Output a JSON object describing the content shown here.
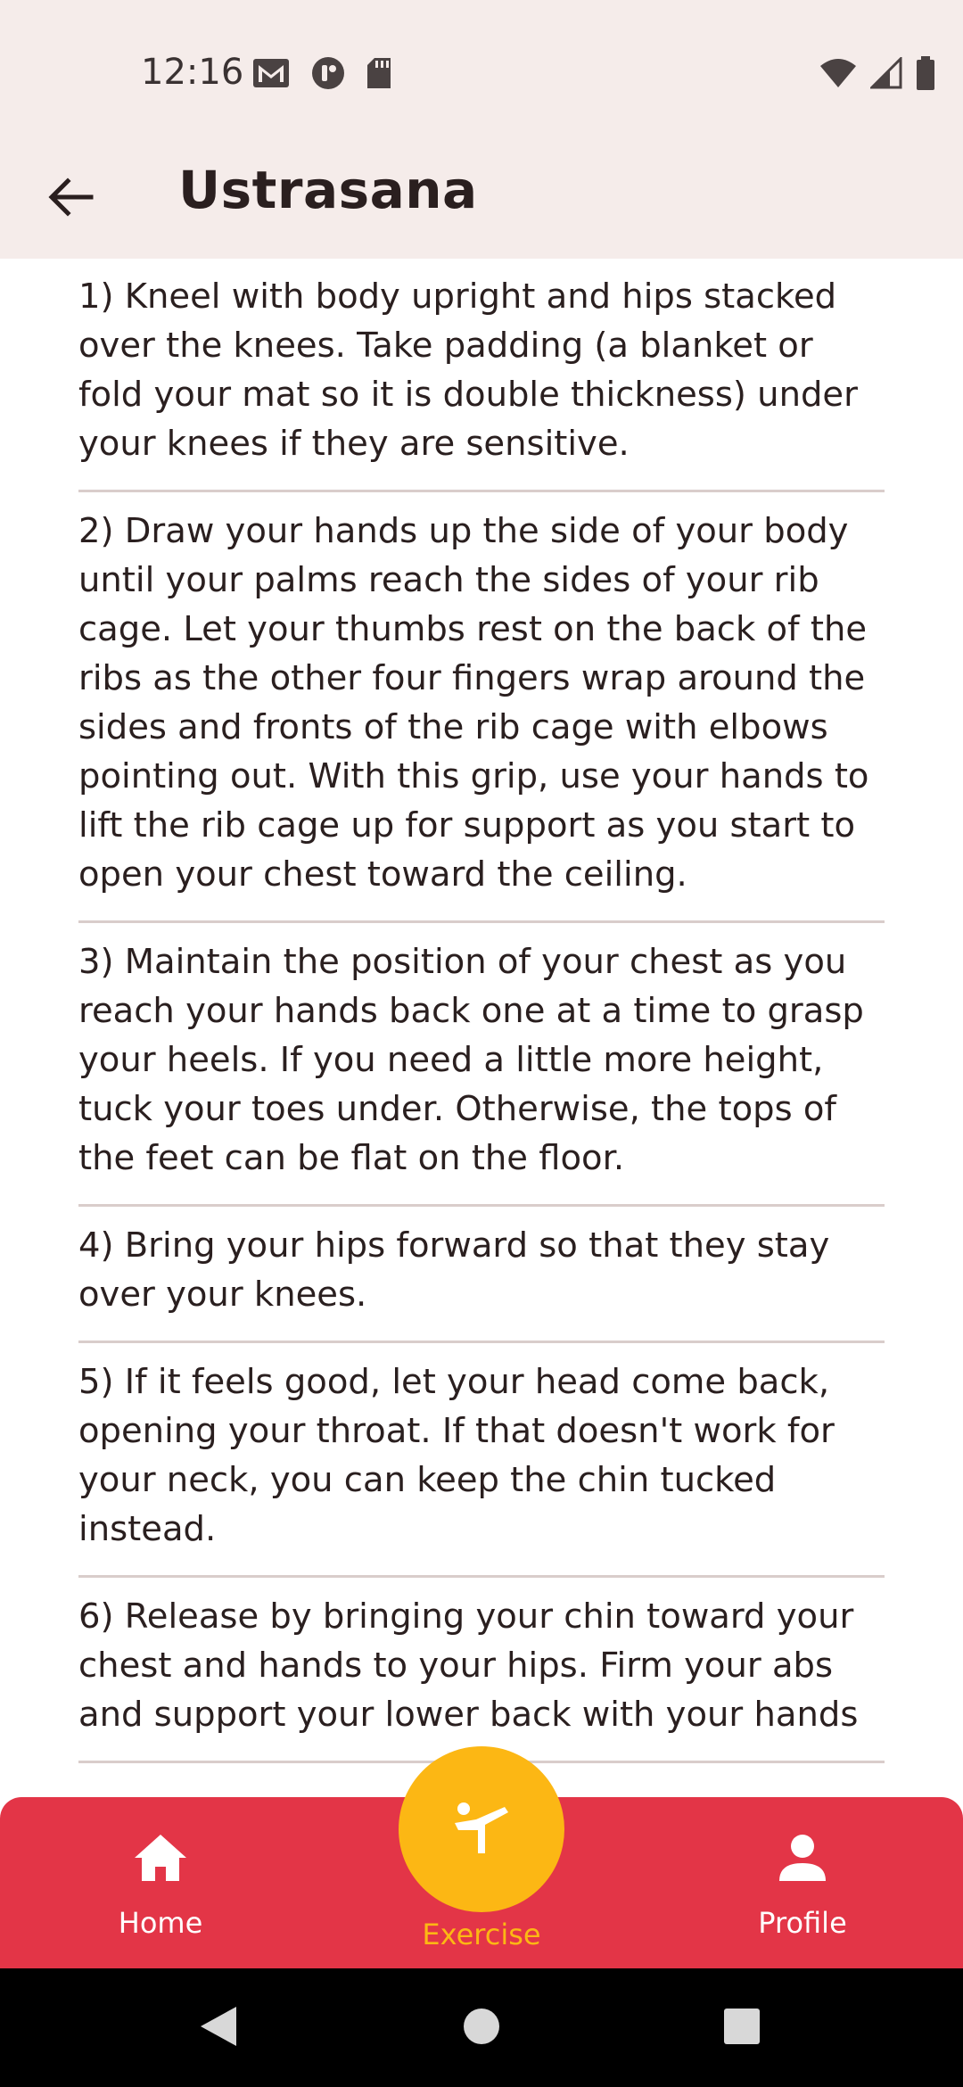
{
  "status_bar": {
    "time": "12:16",
    "left_icons": [
      "gmail-icon",
      "app-notification-icon",
      "sd-card-icon"
    ],
    "right_icons": [
      "wifi-icon",
      "signal-icon",
      "battery-icon"
    ]
  },
  "app_bar": {
    "back_icon": "arrow-left-icon",
    "title": "Ustrasana"
  },
  "steps": [
    "1) Kneel with body upright and hips stacked over the knees. Take padding (a blanket or fold your mat so it is double thickness) under your knees if they are sensitive.",
    "2) Draw your hands up the side of your body until your palms reach the sides of your rib cage. Let your thumbs rest on the back of the ribs as the other four fingers wrap around the sides and fronts of the rib cage with elbows pointing out. With this grip, use your hands to lift the rib cage up for support as you start to open your chest toward the ceiling.",
    "3) Maintain the position of your chest as you reach your hands back one at a time to grasp your heels. If you need a little more height, tuck your toes under. Otherwise, the tops of the feet can be flat on the floor.",
    "4) Bring your hips forward so that they stay over your knees.",
    "5) If it feels good, let your head come back, opening your throat. If that doesn't work for your neck, you can keep the chin tucked instead.",
    "6) Release by bringing your chin toward your chest and hands to your hips. Firm your abs and support your lower back with your hands"
  ],
  "bottom_nav": {
    "home": {
      "label": "Home",
      "icon": "home-icon"
    },
    "exercise": {
      "label": "Exercise",
      "icon": "exercise-icon"
    },
    "profile": {
      "label": "Profile",
      "icon": "person-icon"
    },
    "colors": {
      "bar": "#e33547",
      "active": "#fcb714",
      "inactive": "#ffffff"
    }
  },
  "system_nav": [
    "back-triangle-icon",
    "home-circle-icon",
    "recents-square-icon"
  ]
}
